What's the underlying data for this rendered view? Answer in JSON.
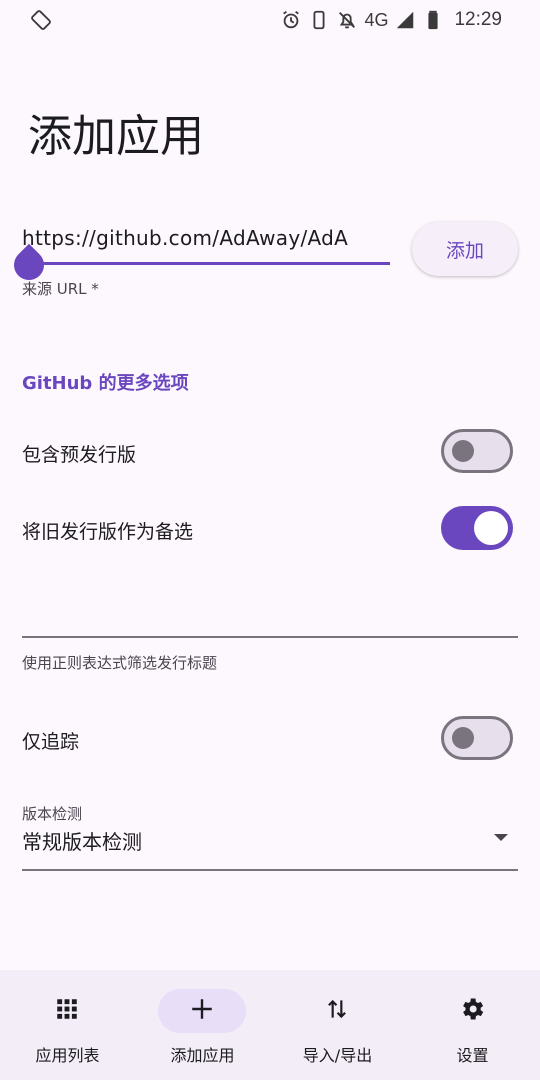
{
  "status_bar": {
    "network": "4G",
    "time": "12:29",
    "icons": [
      "rotate-icon",
      "alarm-icon",
      "phone-icon",
      "notifications-off-icon",
      "signal-icon",
      "battery-icon"
    ]
  },
  "page": {
    "title": "添加应用"
  },
  "url_field": {
    "value": "https://github.com/AdAway/AdA",
    "label": "来源 URL *"
  },
  "add_button": {
    "label": "添加"
  },
  "github_options": {
    "header": "GitHub 的更多选项",
    "include_prereleases": {
      "label": "包含预发行版",
      "on": false
    },
    "fallback_older": {
      "label": "将旧发行版作为备选",
      "on": true
    },
    "regex_filter": {
      "value": "",
      "label": "使用正则表达式筛选发行标题"
    },
    "track_only": {
      "label": "仅追踪",
      "on": false
    }
  },
  "version_detection": {
    "label": "版本检测",
    "selected": "常规版本检测"
  },
  "bottom_nav": {
    "items": [
      {
        "label": "应用列表",
        "icon": "apps-grid-icon",
        "active": false
      },
      {
        "label": "添加应用",
        "icon": "add-icon",
        "active": true
      },
      {
        "label": "导入/导出",
        "icon": "import-export-icon",
        "active": false
      },
      {
        "label": "设置",
        "icon": "settings-gear-icon",
        "active": false
      }
    ]
  },
  "colors": {
    "accent": "#6b47bf",
    "background": "#fdf8fd",
    "nav_background": "#f3edf7",
    "nav_active_pill": "#e8def8"
  }
}
